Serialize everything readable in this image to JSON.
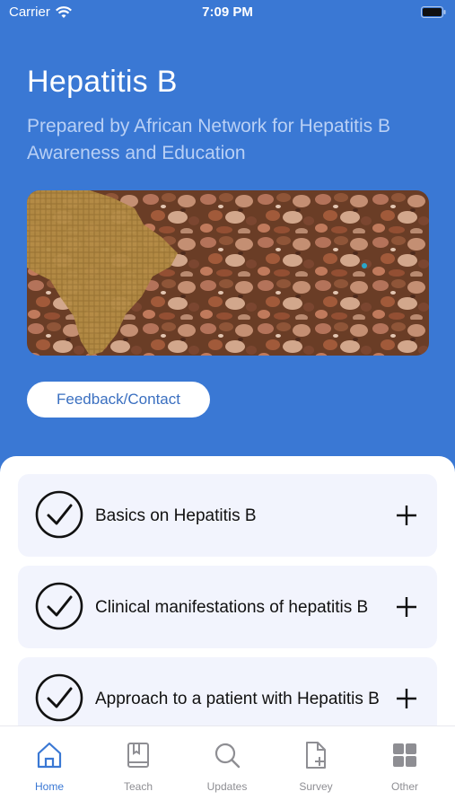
{
  "status_bar": {
    "carrier": "Carrier",
    "time": "7:09 PM"
  },
  "header": {
    "title": "Hepatitis B",
    "subtitle": "Prepared by African Network for Hepatitis B Awareness and Education"
  },
  "feedback_button": {
    "label": "Feedback/Contact"
  },
  "topics": [
    {
      "label": "Basics on Hepatitis B"
    },
    {
      "label": "Clinical manifestations of hepatitis B"
    },
    {
      "label": "Approach to a patient with Hepatitis B"
    }
  ],
  "tabs": [
    {
      "label": "Home",
      "icon": "home-icon",
      "active": true
    },
    {
      "label": "Teach",
      "icon": "book-icon",
      "active": false
    },
    {
      "label": "Updates",
      "icon": "search-icon",
      "active": false
    },
    {
      "label": "Survey",
      "icon": "document-add-icon",
      "active": false
    },
    {
      "label": "Other",
      "icon": "grid-icon",
      "active": false
    }
  ],
  "colors": {
    "header_bg": "#3a78d4",
    "subtitle": "#b9d0f5",
    "card_bg": "#f2f4fd",
    "tab_active": "#3a78d4",
    "tab_inactive": "#8e8e93"
  }
}
